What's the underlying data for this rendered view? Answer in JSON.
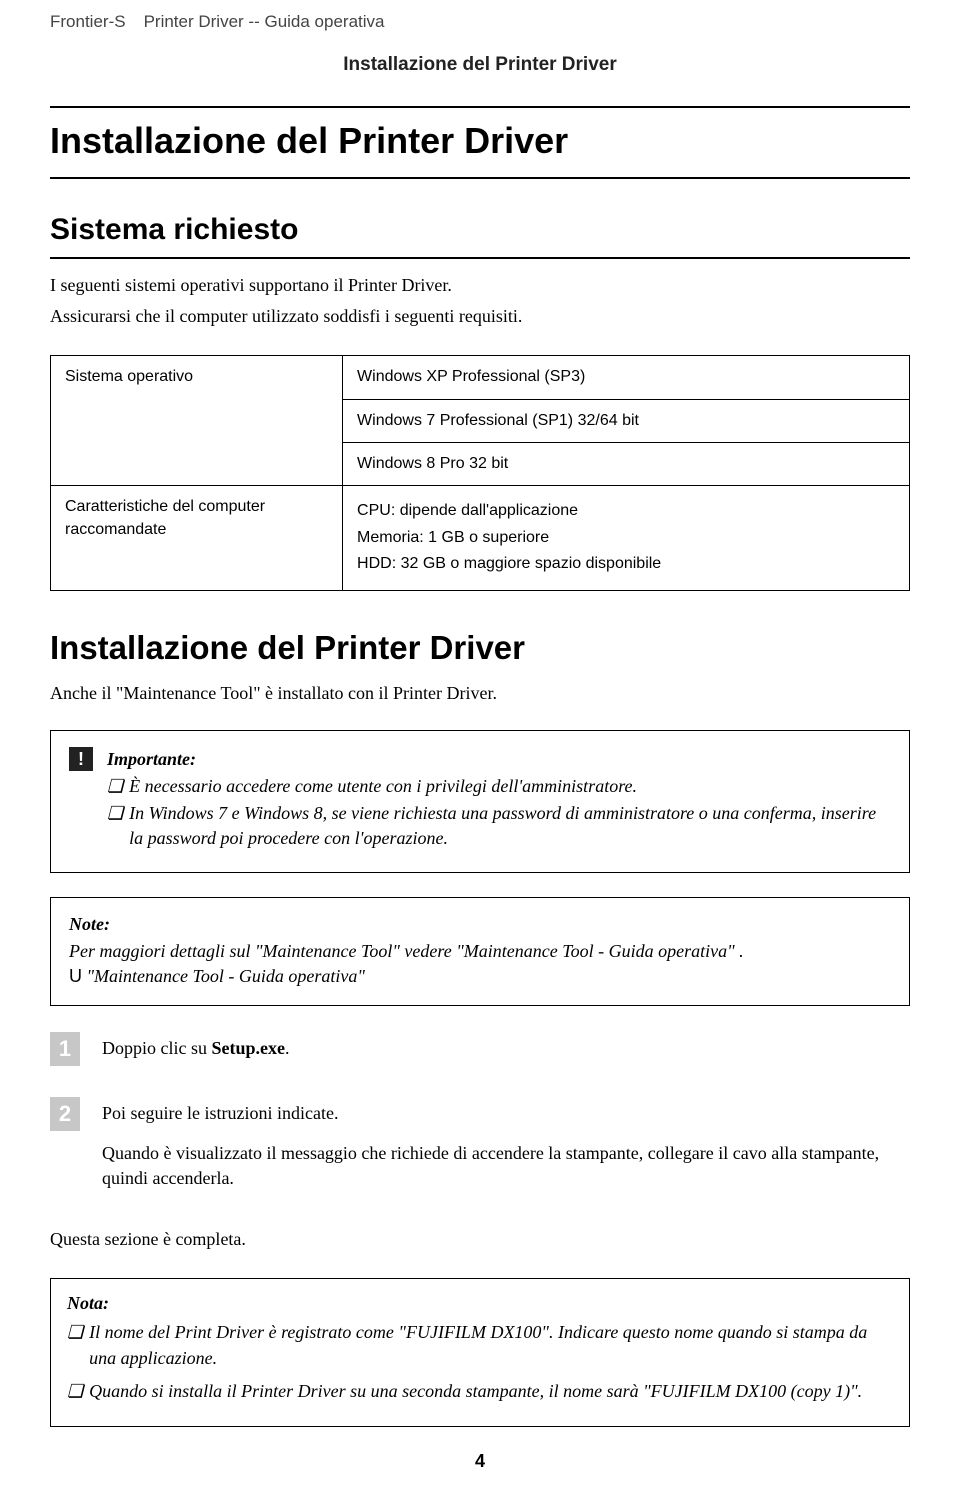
{
  "header": {
    "product": "Frontier-S",
    "doc": "Printer Driver -- Guida operativa"
  },
  "section_label": "Installazione del Printer Driver",
  "h1": "Installazione del Printer Driver",
  "sistema": {
    "title": "Sistema richiesto",
    "p1": "I seguenti sistemi operativi supportano il Printer Driver.",
    "p2": "Assicurarsi che il computer utilizzato soddisfi i seguenti requisiti."
  },
  "table": {
    "os_label": "Sistema operativo",
    "os1": "Windows XP Professional (SP3)",
    "os2": "Windows 7 Professional (SP1) 32/64 bit",
    "os3": "Windows 8 Pro 32 bit",
    "spec_label": "Caratteristiche del computer raccomandate",
    "spec1": "CPU: dipende dall'applicazione",
    "spec2": "Memoria: 1 GB o superiore",
    "spec3": "HDD: 32 GB o maggiore spazio disponibile"
  },
  "install2": {
    "title": "Installazione del Printer Driver",
    "lead": "Anche il \"Maintenance Tool\" è installato con il Printer Driver."
  },
  "importante": {
    "title": "Importante:",
    "b1": "È necessario accedere come utente con i privilegi dell'amministratore.",
    "b2": "In Windows 7 e Windows 8, se viene richiesta una password di amministratore o una conferma, inserire la password poi procedere con l'operazione."
  },
  "note": {
    "title": "Note:",
    "p": "Per maggiori dettagli sul \"Maintenance Tool\" vedere \"Maintenance Tool - Guida operativa\" .",
    "ref_u": "U",
    "ref": " \"Maintenance Tool - Guida operativa\""
  },
  "steps": {
    "s1_pre": "Doppio clic su ",
    "s1_bold": "Setup.exe",
    "s1_post": ".",
    "s2a": "Poi seguire le istruzioni indicate.",
    "s2b": "Quando è visualizzato il messaggio che richiede di accendere la stampante, collegare il cavo alla stampante, quindi accenderla."
  },
  "complete": "Questa sezione è completa.",
  "nota": {
    "title": "Nota:",
    "b1": "Il nome del Print Driver è registrato come \"FUJIFILM DX100\". Indicare questo nome quando si stampa da una applicazione.",
    "b2": "Quando si installa il Printer Driver su una seconda stampante, il nome sarà \"FUJIFILM DX100 (copy 1)\"."
  },
  "page": "4",
  "marks": {
    "bullet": "❏",
    "num1": "1",
    "num2": "2",
    "excl": "!"
  }
}
